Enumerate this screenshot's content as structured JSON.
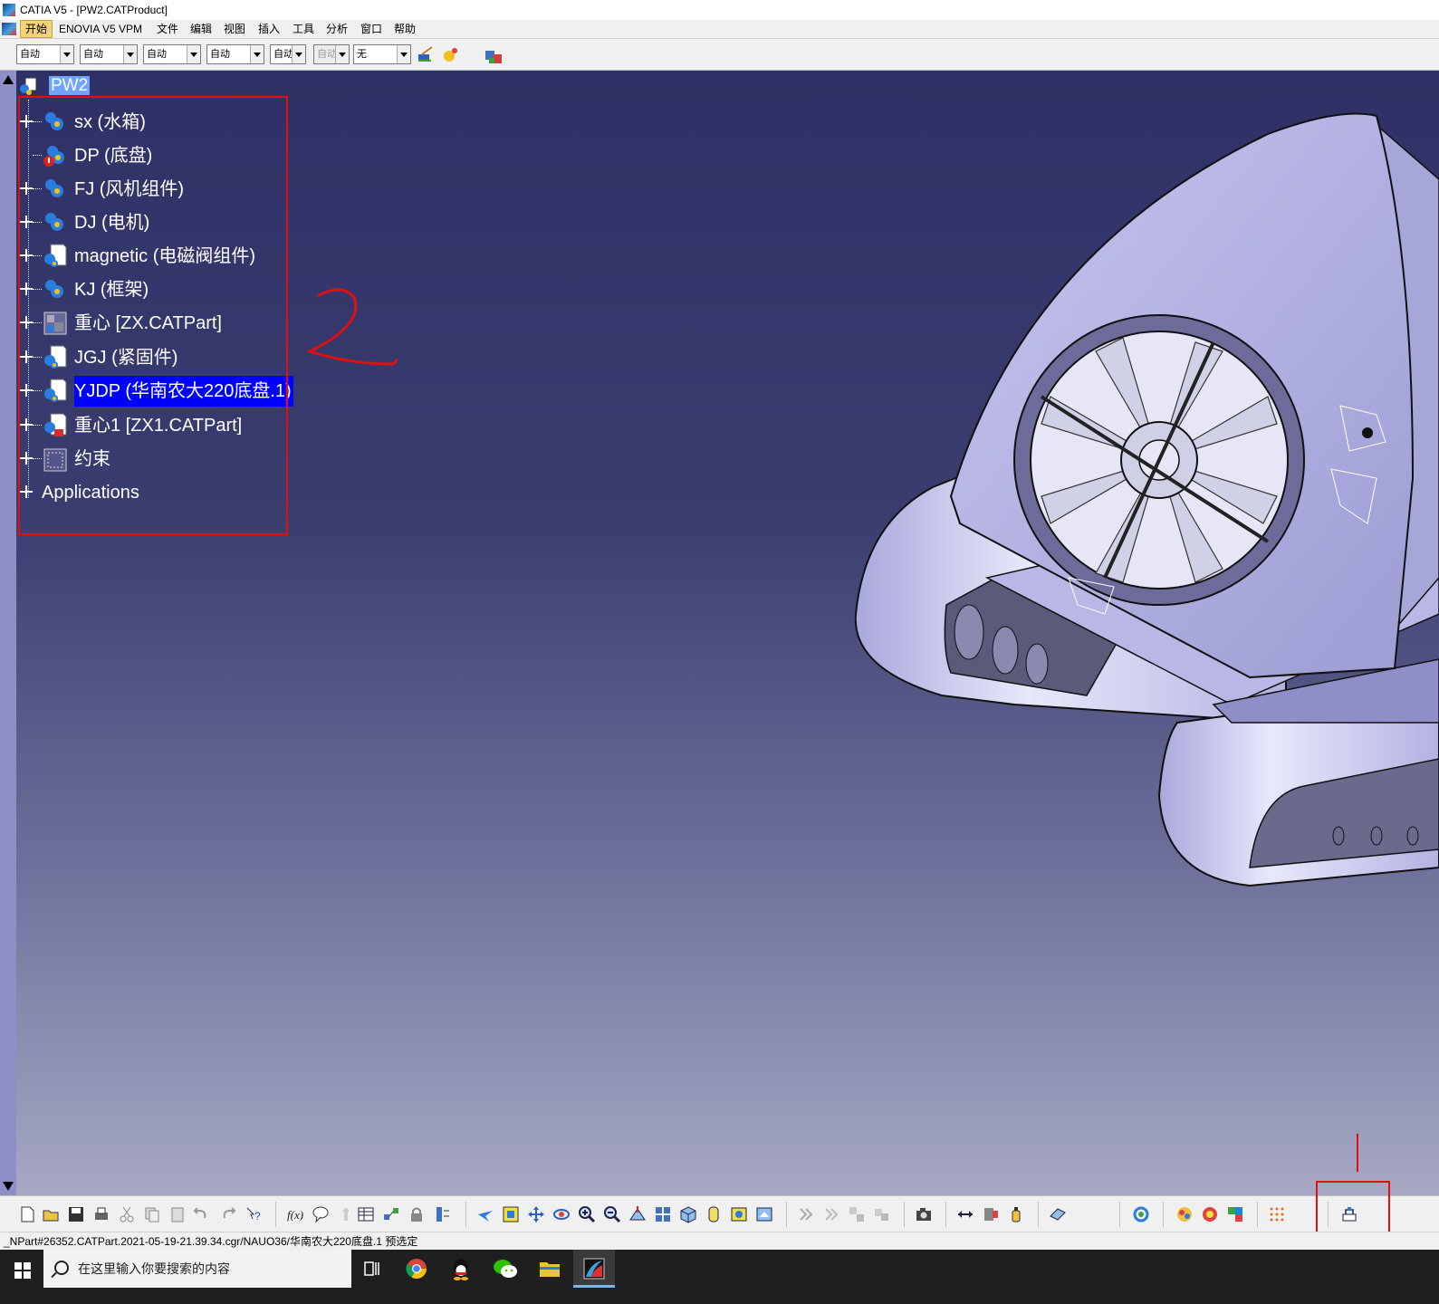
{
  "window": {
    "title": "CATIA V5 - [PW2.CATProduct]"
  },
  "menubar": {
    "items": [
      "开始",
      "ENOVIA V5 VPM",
      "文件",
      "编辑",
      "视图",
      "插入",
      "工具",
      "分析",
      "窗口",
      "帮助"
    ]
  },
  "toolbar": {
    "combos": [
      "自动",
      "自动",
      "自动",
      "自动",
      "自动",
      "自动",
      "无"
    ]
  },
  "tree": {
    "root": "PW2",
    "nodes": [
      {
        "label": "sx (水箱)",
        "expandable": true,
        "icon": "product-gear-icon"
      },
      {
        "label": "DP (底盘)",
        "expandable": false,
        "icon": "product-gear-error-icon"
      },
      {
        "label": "FJ (风机组件)",
        "expandable": true,
        "icon": "product-gear-icon"
      },
      {
        "label": "DJ (电机)",
        "expandable": true,
        "icon": "product-gear-icon"
      },
      {
        "label": "magnetic (电磁阀组件)",
        "expandable": true,
        "icon": "product-doc-gear-icon"
      },
      {
        "label": "KJ (框架)",
        "expandable": true,
        "icon": "product-gear-icon"
      },
      {
        "label": "重心 [ZX.CATPart]",
        "expandable": true,
        "icon": "part-icon"
      },
      {
        "label": "JGJ (紧固件)",
        "expandable": true,
        "icon": "product-doc-gear-icon"
      },
      {
        "label": "YJDP (华南农大220底盘.1)",
        "expandable": true,
        "icon": "product-doc-gear-icon",
        "selected": true
      },
      {
        "label": "重心1 [ZX1.CATPart]",
        "expandable": true,
        "icon": "part-doc-icon"
      },
      {
        "label": "约束",
        "expandable": true,
        "icon": "constraints-icon"
      },
      {
        "label": "Applications",
        "expandable": true,
        "icon": ""
      }
    ]
  },
  "annotation": {
    "handwritten": "2"
  },
  "statusbar": {
    "text": "_NPart#26352.CATPart.2021-05-19-21.39.34.cgr/NAUO36/华南农大220底盘.1 预选定"
  },
  "taskbar": {
    "search_placeholder": "在这里输入你要搜索的内容"
  },
  "colors": {
    "viewport_top": "#2f3166",
    "viewport_bottom": "#a6a8c4",
    "selection": "#0000ff",
    "annotation_red": "#e01010"
  }
}
